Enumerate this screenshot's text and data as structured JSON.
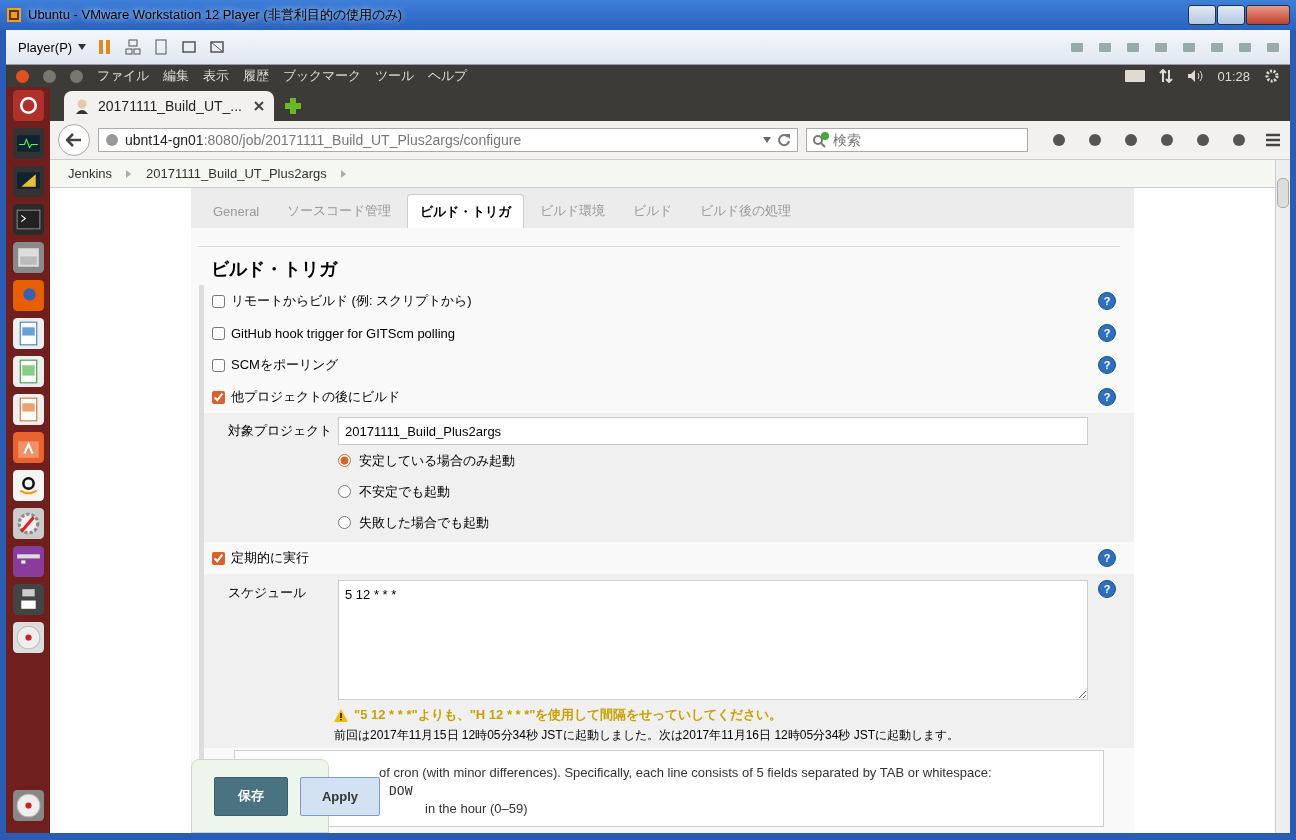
{
  "window": {
    "title": "Ubuntu - VMware Workstation 12 Player (非営利目的の使用のみ)"
  },
  "player_toolbar": {
    "menu": "Player(P)"
  },
  "desktop_menu": [
    "ファイル",
    "編集",
    "表示",
    "履歴",
    "ブックマーク",
    "ツール",
    "ヘルプ"
  ],
  "clock": "01:28",
  "browser_tab": {
    "title": "20171111_Build_UT_..."
  },
  "address_bar": {
    "host": "ubnt14-gn01",
    "path": ":8080/job/20171111_Build_UT_Plus2args/configure"
  },
  "search": {
    "placeholder": "検索"
  },
  "breadcrumbs": [
    "Jenkins",
    "20171111_Build_UT_Plus2args"
  ],
  "config_tabs": [
    {
      "label": "General",
      "selected": false
    },
    {
      "label": "ソースコード管理",
      "selected": false
    },
    {
      "label": "ビルド・トリガ",
      "selected": true
    },
    {
      "label": "ビルド環境",
      "selected": false
    },
    {
      "label": "ビルド",
      "selected": false
    },
    {
      "label": "ビルド後の処理",
      "selected": false
    }
  ],
  "section_title": "ビルド・トリガ",
  "triggers": [
    {
      "kind": "plain",
      "label": "リモートからビルド (例: スクリプトから)",
      "checked": false,
      "help_icon": "?"
    },
    {
      "kind": "plain",
      "label": "GitHub hook trigger for GITScm polling",
      "checked": false,
      "help_icon": "?"
    },
    {
      "kind": "plain",
      "label": "SCMをポーリング",
      "checked": false,
      "help_icon": "?"
    },
    {
      "kind": "upstream",
      "label": "他プロジェクトの後にビルド",
      "checked": true,
      "help_icon": "?",
      "field_label": "対象プロジェクト",
      "field_value": "20171111_Build_Plus2args",
      "options": [
        {
          "label": "安定している場合のみ起動",
          "selected": true
        },
        {
          "label": "不安定でも起動",
          "selected": false
        },
        {
          "label": "失敗した場合でも起動",
          "selected": false
        }
      ]
    },
    {
      "kind": "schedule",
      "label": "定期的に実行",
      "checked": true,
      "help_icon": "?",
      "field_label": "スケジュール",
      "field_value": "5 12 * * *",
      "field_help_icon": "?",
      "warning": "\"5 12 * * *\"よりも、\"H 12 * * *\"を使用して間隔をせっていしてください。",
      "next_run": "前回は2017年11月15日 12時05分34秒 JSTに起動しました。次は2017年11月16日 12時05分34秒 JSTに起動します。",
      "help": [
        {
          "kind": "prose",
          "text": "of cron (with minor differences). Specifically, each line consists of 5 fields separated by TAB or whitespace:"
        },
        {
          "kind": "mono",
          "text": "DOW"
        },
        {
          "kind": "prose",
          "text": "in the hour (0–59)"
        }
      ]
    }
  ],
  "save_bar": {
    "buttons": [
      {
        "kind": "primary",
        "label": "保存"
      },
      {
        "kind": "secondary",
        "label": "Apply"
      }
    ]
  }
}
